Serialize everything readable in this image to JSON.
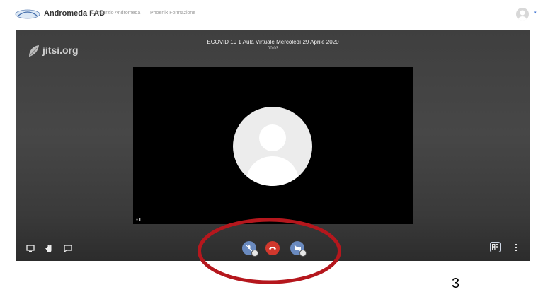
{
  "header": {
    "brand": "Andromeda FAD",
    "nav": [
      "Consorzio Andromeda",
      "Phoenix Formazione"
    ]
  },
  "conference": {
    "logo_text": "jitsi.org",
    "title": "ECOVID 19 1 Aula Virtuale Mercoledì 29 Aprile 2020",
    "timer": "00:03"
  },
  "colors": {
    "hangup": "#d1382d",
    "control_blue": "#6a8abf",
    "annotation": "#b5171d"
  },
  "icons": {
    "toolbar_left": [
      "screen-share-icon",
      "raise-hand-icon",
      "chat-icon"
    ],
    "toolbar_center": [
      "microphone-icon",
      "hangup-icon",
      "camera-icon"
    ],
    "toolbar_right": [
      "tile-view-icon",
      "more-icon"
    ]
  },
  "annotation": {
    "corner_text": "3"
  }
}
